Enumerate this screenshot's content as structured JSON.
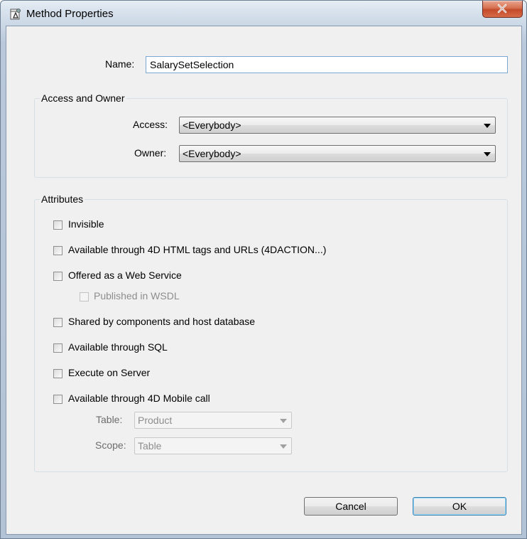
{
  "window": {
    "title": "Method Properties",
    "close_glyph": "X",
    "icon": "method-properties-icon"
  },
  "name_field": {
    "label": "Name:",
    "value": "SalarySetSelection"
  },
  "access_group": {
    "title": "Access and Owner",
    "access_label": "Access:",
    "access_value": "<Everybody>",
    "owner_label": "Owner:",
    "owner_value": "<Everybody>"
  },
  "attributes_group": {
    "title": "Attributes",
    "checkboxes": [
      {
        "label": "Invisible",
        "checked": false,
        "enabled": true
      },
      {
        "label": "Available through 4D HTML tags and URLs (4DACTION...)",
        "checked": false,
        "enabled": true
      },
      {
        "label": "Offered as a Web Service",
        "checked": false,
        "enabled": true
      },
      {
        "label": "Published in WSDL",
        "checked": false,
        "enabled": false
      },
      {
        "label": "Shared by components and host database",
        "checked": false,
        "enabled": true
      },
      {
        "label": "Available through SQL",
        "checked": false,
        "enabled": true
      },
      {
        "label": "Execute on Server",
        "checked": false,
        "enabled": true
      },
      {
        "label": "Available through 4D Mobile call",
        "checked": false,
        "enabled": true
      }
    ],
    "table_label": "Table:",
    "table_value": "Product",
    "scope_label": "Scope:",
    "scope_value": "Table"
  },
  "buttons": {
    "cancel": "Cancel",
    "ok": "OK"
  }
}
